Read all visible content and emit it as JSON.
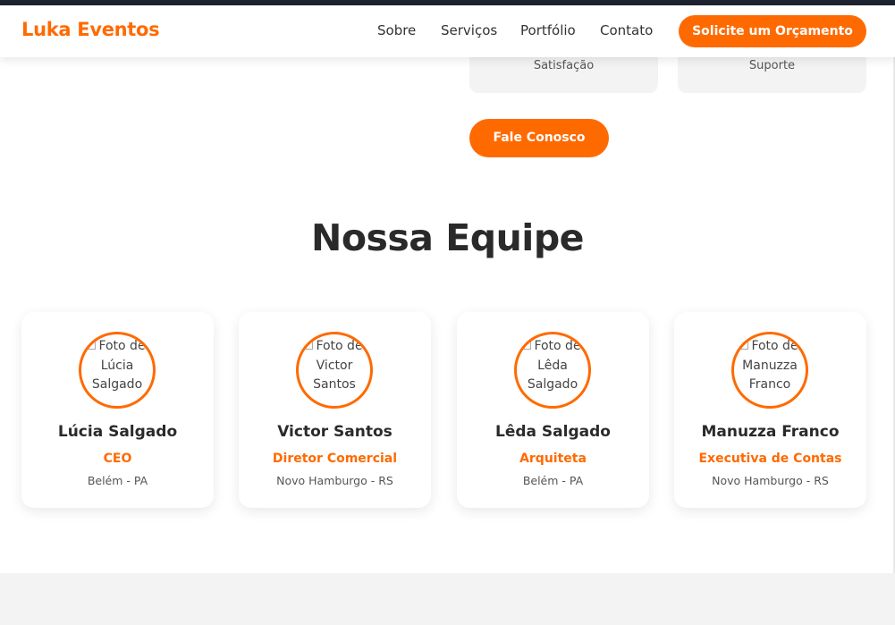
{
  "header": {
    "logo": "Luka Eventos",
    "nav": [
      "Sobre",
      "Serviços",
      "Portfólio",
      "Contato"
    ],
    "cta_label": "Solicite um Orçamento"
  },
  "stats": [
    {
      "label": "Satisfação"
    },
    {
      "label": "Suporte"
    }
  ],
  "contact_button": "Fale Conosco",
  "team_section": {
    "title": "Nossa Equipe",
    "members": [
      {
        "photo_alt_lines": [
          "Foto de",
          "Lúcia",
          "Salgado"
        ],
        "name": "Lúcia Salgado",
        "role": "CEO",
        "location": "Belém - PA"
      },
      {
        "photo_alt_lines": [
          "Foto de",
          "Victor",
          "Santos"
        ],
        "name": "Victor Santos",
        "role": "Diretor Comercial",
        "location": "Novo Hamburgo - RS"
      },
      {
        "photo_alt_lines": [
          "Foto de",
          "Lêda",
          "Salgado"
        ],
        "name": "Lêda Salgado",
        "role": "Arquiteta",
        "location": "Belém - PA"
      },
      {
        "photo_alt_lines": [
          "Foto de",
          "Manuzza",
          "Franco"
        ],
        "name": "Manuzza Franco",
        "role": "Executiva de Contas",
        "location": "Novo Hamburgo - RS"
      }
    ]
  },
  "colors": {
    "accent": "#ff6a00",
    "top_strip": "#1d2330",
    "stat_background": "#f3f3f3",
    "footer_band": "#f3f3f3"
  }
}
